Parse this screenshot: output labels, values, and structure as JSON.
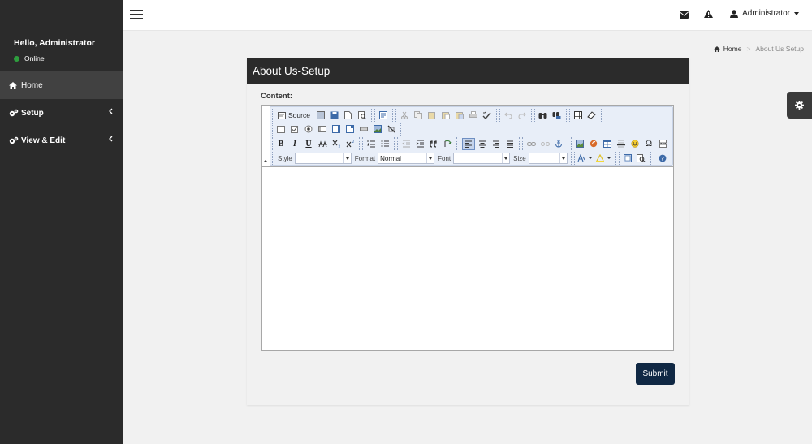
{
  "sidebar": {
    "greeting": "Hello, Administrator",
    "status": "Online",
    "items": [
      {
        "label": "Home",
        "icon": "home-icon"
      },
      {
        "label": "Setup",
        "icon": "cogs-icon"
      },
      {
        "label": "View & Edit",
        "icon": "cogs-icon"
      }
    ]
  },
  "header": {
    "user": "Administrator",
    "icons": [
      "menu-icon",
      "envelope-icon",
      "warning-icon",
      "user-icon"
    ]
  },
  "breadcrumb": {
    "home": "Home",
    "separator": ">",
    "current": "About Us Setup"
  },
  "panel": {
    "title": "About Us-Setup",
    "content_label": "Content:",
    "submit": "Submit"
  },
  "editor": {
    "source_label": "Source",
    "style_label": "Style",
    "style_value": "",
    "format_label": "Format",
    "format_value": "Normal",
    "font_label": "Font",
    "font_value": "",
    "size_label": "Size",
    "size_value": "",
    "bold": "B",
    "italic": "I",
    "underline": "U",
    "omega": "Ω"
  },
  "colors": {
    "sidebar_bg": "#2b2b2b",
    "sidebar_active": "#414141",
    "panel_header": "#2b2b2b",
    "submit_bg": "#102844",
    "status_online": "#2e9e3e"
  }
}
